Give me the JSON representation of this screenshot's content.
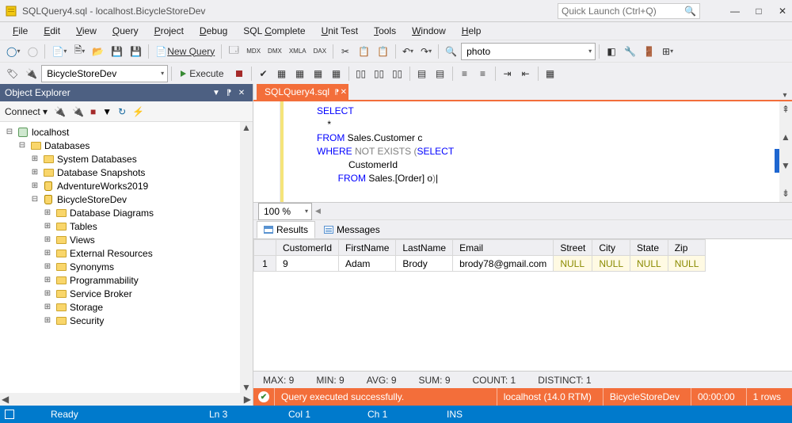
{
  "window": {
    "title": "SQLQuery4.sql - localhost.BicycleStoreDev",
    "quick_launch_placeholder": "Quick Launch (Ctrl+Q)"
  },
  "menu": [
    "File",
    "Edit",
    "View",
    "Query",
    "Project",
    "Debug",
    "SQL Complete",
    "Unit Test",
    "Tools",
    "Window",
    "Help"
  ],
  "toolbar1": {
    "new_query": "New Query",
    "combo_value": "photo"
  },
  "toolbar2": {
    "db_selected": "BicycleStoreDev",
    "execute_label": "Execute"
  },
  "object_explorer": {
    "title": "Object Explorer",
    "connect_label": "Connect",
    "tree": {
      "server": "localhost",
      "databases_label": "Databases",
      "sys_db": "System Databases",
      "snapshots": "Database Snapshots",
      "adventure": "AdventureWorks2019",
      "bicycle": "BicycleStoreDev",
      "children": [
        "Database Diagrams",
        "Tables",
        "Views",
        "External Resources",
        "Synonyms",
        "Programmability",
        "Service Broker",
        "Storage",
        "Security"
      ]
    }
  },
  "editor": {
    "tab_title": "SQLQuery4.sql",
    "zoom": "100 %",
    "code": {
      "l1a": "SELECT",
      "l2": "    *",
      "l3a": "FROM",
      "l3b": " Sales.Customer c",
      "l4a": "WHERE",
      "l4b": " NOT EXISTS ",
      "l4c": "(",
      "l4d": "SELECT",
      "l5": "            CustomerId",
      "l6a": "        ",
      "l6b": "FROM",
      "l6c": " Sales.",
      "l6d": "[Order]",
      "l6e": " o",
      "l6f": ")"
    }
  },
  "results": {
    "tab_results": "Results",
    "tab_messages": "Messages",
    "columns": [
      "CustomerId",
      "FirstName",
      "LastName",
      "Email",
      "Street",
      "City",
      "State",
      "Zip"
    ],
    "row": {
      "n": "1",
      "CustomerId": "9",
      "FirstName": "Adam",
      "LastName": "Brody",
      "Email": "brody78@gmail.com",
      "Street": "NULL",
      "City": "NULL",
      "State": "NULL",
      "Zip": "NULL"
    },
    "stats": {
      "max": "MAX:  9",
      "min": "MIN:  9",
      "avg": "AVG:  9",
      "sum": "SUM:  9",
      "count": "COUNT:  1",
      "distinct": "DISTINCT:  1"
    },
    "status": {
      "msg": "Query executed successfully.",
      "server": "localhost (14.0 RTM)",
      "db": "BicycleStoreDev",
      "time": "00:00:00",
      "rows": "1 rows"
    }
  },
  "footer": {
    "ready": "Ready",
    "ln": "Ln 3",
    "col": "Col 1",
    "ch": "Ch 1",
    "ins": "INS"
  }
}
